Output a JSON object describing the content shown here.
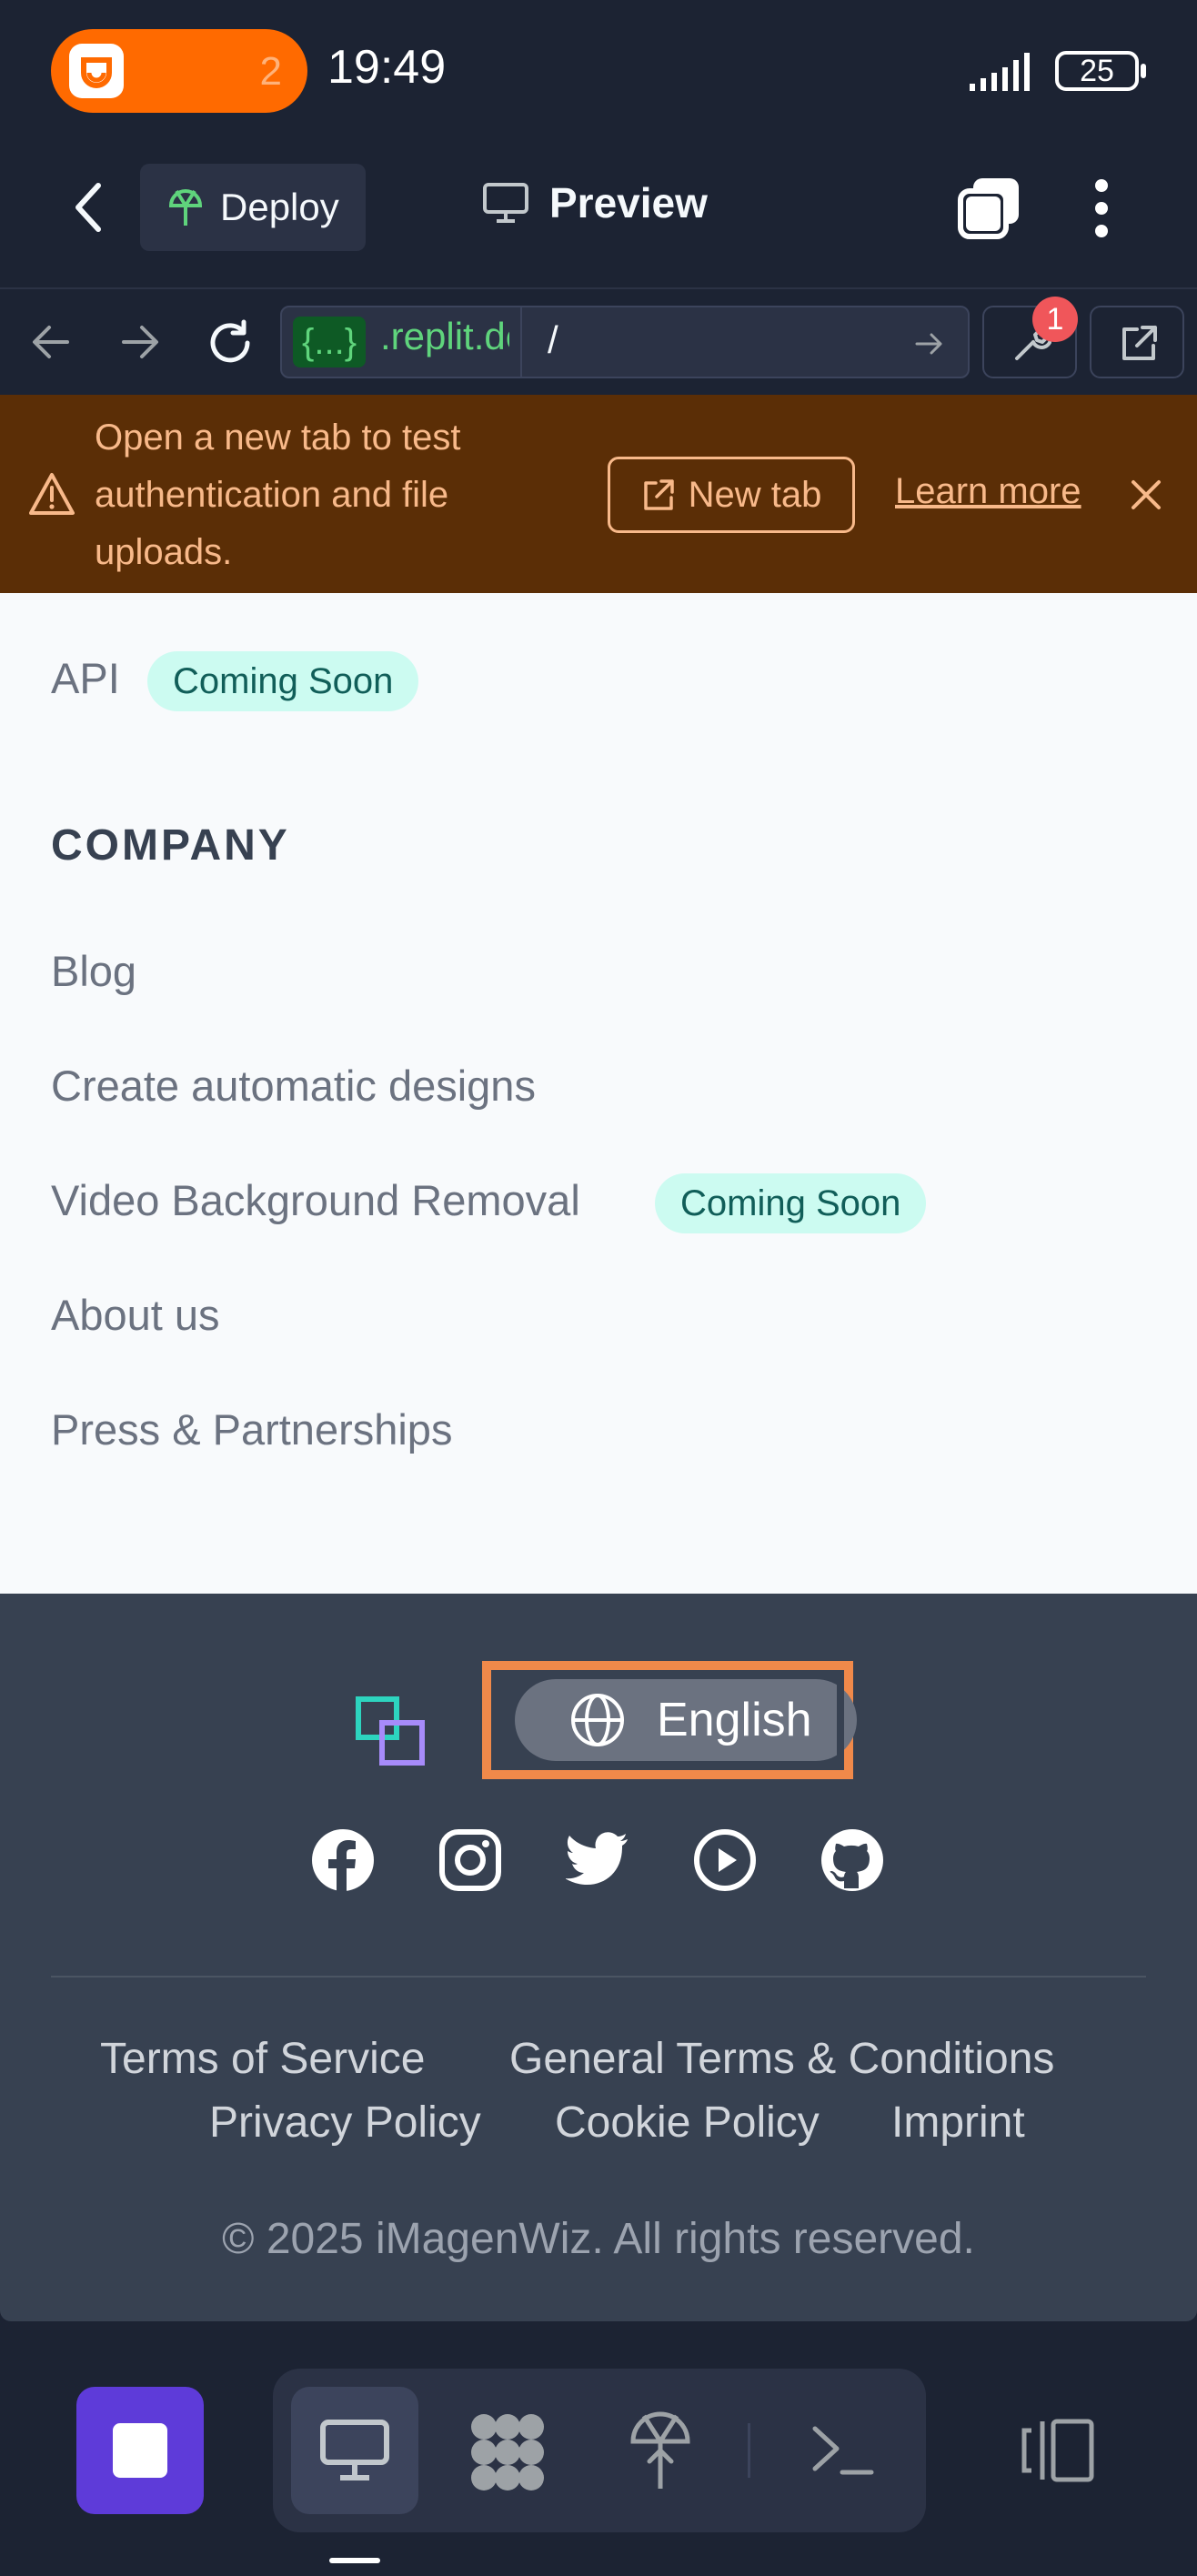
{
  "status_bar": {
    "recording_count": "2",
    "time": "19:49",
    "battery": "25"
  },
  "header": {
    "deploy_label": "Deploy",
    "title": "Preview"
  },
  "url_bar": {
    "host_badge": "{...}",
    "host_rest": ".replit.de",
    "path": "/",
    "notification_count": "1"
  },
  "banner": {
    "message": "Open a new tab to test authentication and file uploads.",
    "new_tab_label": "New tab",
    "learn_more_label": "Learn more"
  },
  "content": {
    "api_label": "API",
    "coming_soon": "Coming Soon",
    "company_heading": "COMPANY",
    "company_links": [
      "Blog",
      "Create automatic designs",
      "Video Background Removal",
      "About us",
      "Press & Partnerships"
    ]
  },
  "footer": {
    "language": "English",
    "social": [
      "facebook",
      "instagram",
      "twitter",
      "youtube",
      "github"
    ],
    "links_row1": [
      "Terms of Service",
      "General Terms & Conditions"
    ],
    "links_row2": [
      "Privacy Policy",
      "Cookie Policy",
      "Imprint"
    ],
    "copyright": "© 2025 iMagenWiz. All rights reserved."
  },
  "colors": {
    "app_bg": "#1c2333",
    "banner_bg": "#5b2e06",
    "accent_orange": "#f0894a",
    "stop_button": "#5e3bd9",
    "badge_teal": "#ccfbf1"
  }
}
